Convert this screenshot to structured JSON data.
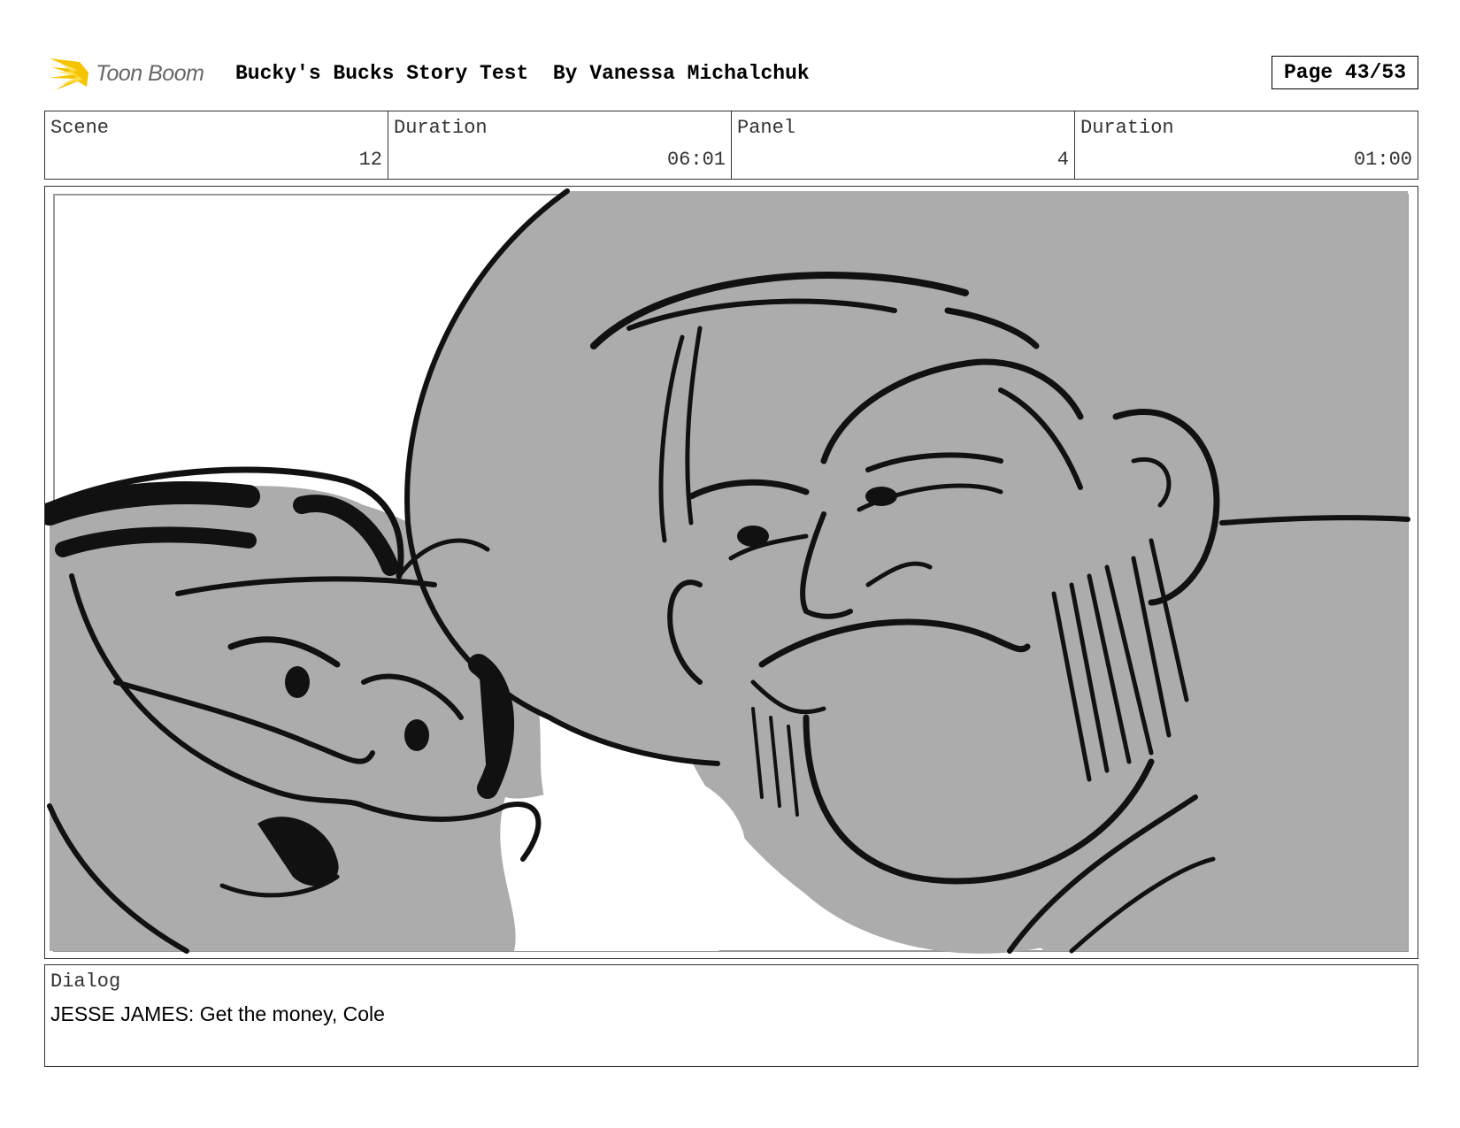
{
  "header": {
    "logo_text": "Toon Boom",
    "title": "Bucky's Bucks Story Test  By Vanessa Michalchuk",
    "page": "Page 43/53"
  },
  "info": {
    "scene_label": "Scene",
    "scene_value": "12",
    "scene_duration_label": "Duration",
    "scene_duration_value": "06:01",
    "panel_label": "Panel",
    "panel_value": "4",
    "panel_duration_label": "Duration",
    "panel_duration_value": "01:00"
  },
  "panel": {
    "icon": "storyboard-sketch-image",
    "fill_color": "#acacac",
    "line_color": "#111111"
  },
  "dialog": {
    "label": "Dialog",
    "text": "JESSE JAMES: Get the money, Cole"
  },
  "colors": {
    "logo_accent": "#f5c400",
    "text": "#000000"
  }
}
